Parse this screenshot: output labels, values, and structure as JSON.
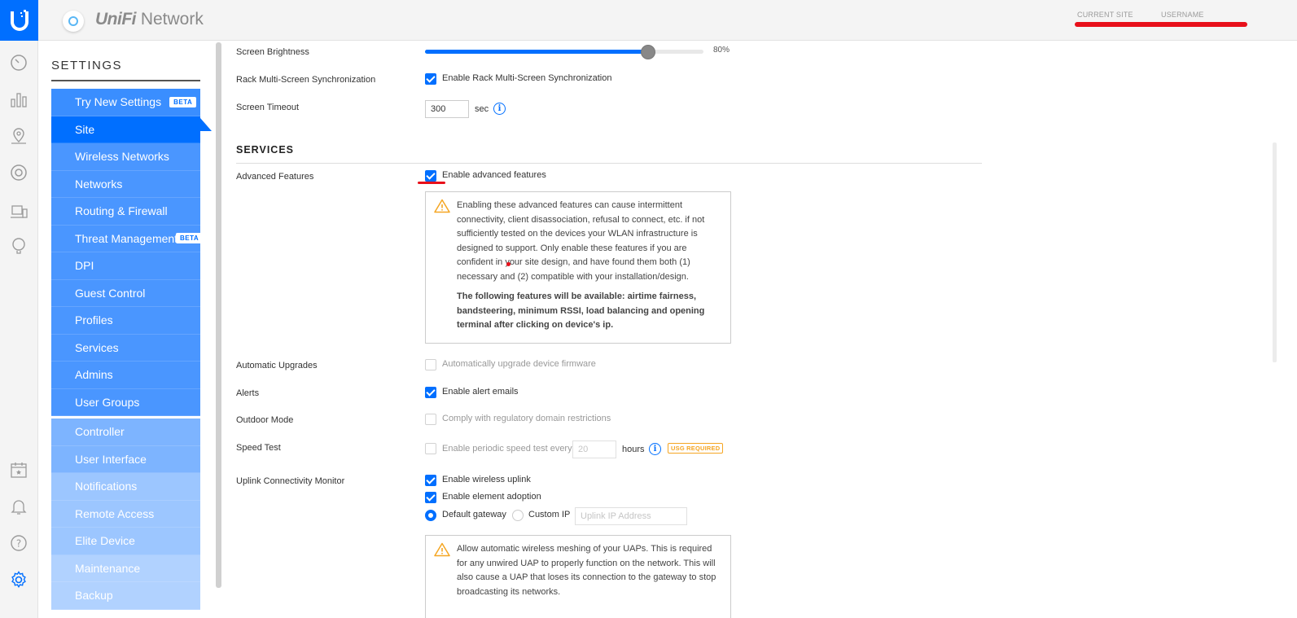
{
  "app": {
    "brand_italic": "UniFi",
    "brand_rest": " Network"
  },
  "topbar": {
    "current_site_label": "CURRENT SITE",
    "username_label": "USERNAME"
  },
  "rail": {
    "icons": [
      "dashboard-icon",
      "statistics-icon",
      "map-icon",
      "devices-icon",
      "clients-icon",
      "insights-icon",
      "events-icon",
      "alerts-icon",
      "help-icon",
      "settings-icon"
    ]
  },
  "sidebar": {
    "title": "SETTINGS",
    "items": [
      {
        "label": "Try New Settings",
        "badge": "BETA"
      },
      {
        "label": "Site"
      },
      {
        "label": "Wireless Networks"
      },
      {
        "label": "Networks"
      },
      {
        "label": "Routing & Firewall"
      },
      {
        "label": "Threat Management",
        "badge": "BETA"
      },
      {
        "label": "DPI"
      },
      {
        "label": "Guest Control"
      },
      {
        "label": "Profiles"
      },
      {
        "label": "Services"
      },
      {
        "label": "Admins"
      },
      {
        "label": "User Groups"
      },
      {
        "label": "Controller"
      },
      {
        "label": "User Interface"
      },
      {
        "label": "Notifications"
      },
      {
        "label": "Remote Access"
      },
      {
        "label": "Elite Device"
      },
      {
        "label": "Maintenance"
      },
      {
        "label": "Backup"
      }
    ]
  },
  "main": {
    "screen_brightness": {
      "label": "Screen Brightness",
      "value": 80,
      "value_text": "80%"
    },
    "rack_sync": {
      "label": "Rack Multi-Screen Synchronization",
      "option": "Enable Rack Multi-Screen Synchronization",
      "checked": true
    },
    "screen_timeout": {
      "label": "Screen Timeout",
      "value": "300",
      "unit": "sec"
    },
    "services_heading": "SERVICES",
    "advanced": {
      "label": "Advanced Features",
      "option": "Enable advanced features",
      "checked": true,
      "warning": "Enabling these advanced features can cause intermittent connectivity, client disassociation, refusal to connect, etc. if not sufficiently tested on the devices your WLAN infrastructure is designed to support. Only enable these features if you are confident in your site design, and have found them both (1) necessary and (2) compatible with your installation/design.",
      "features": "The following features will be available: airtime fairness, bandsteering, minimum RSSI, load balancing and opening terminal after clicking on device's ip."
    },
    "auto_upgrades": {
      "label": "Automatic Upgrades",
      "option": "Automatically upgrade device firmware",
      "checked": false
    },
    "alerts": {
      "label": "Alerts",
      "option": "Enable alert emails",
      "checked": true
    },
    "outdoor": {
      "label": "Outdoor Mode",
      "option": "Comply with regulatory domain restrictions",
      "checked": false
    },
    "speed_test": {
      "label": "Speed Test",
      "option": "Enable periodic speed test every",
      "value": "20",
      "unit": "hours",
      "badge": "USG REQUIRED",
      "checked": false
    },
    "uplink": {
      "label": "Uplink Connectivity Monitor",
      "opt_wireless": "Enable wireless uplink",
      "opt_adoption": "Enable element adoption",
      "radio_default": "Default gateway",
      "radio_custom": "Custom IP",
      "ip_placeholder": "Uplink IP Address",
      "warning": "Allow automatic wireless meshing of your UAPs. This is required for any unwired UAP to properly function on the network. This will also cause a UAP that loses its connection to the gateway to stop broadcasting its networks."
    }
  },
  "colors": {
    "accent": "#006fff",
    "warning": "#f5a623",
    "annotation": "#e8101a"
  }
}
